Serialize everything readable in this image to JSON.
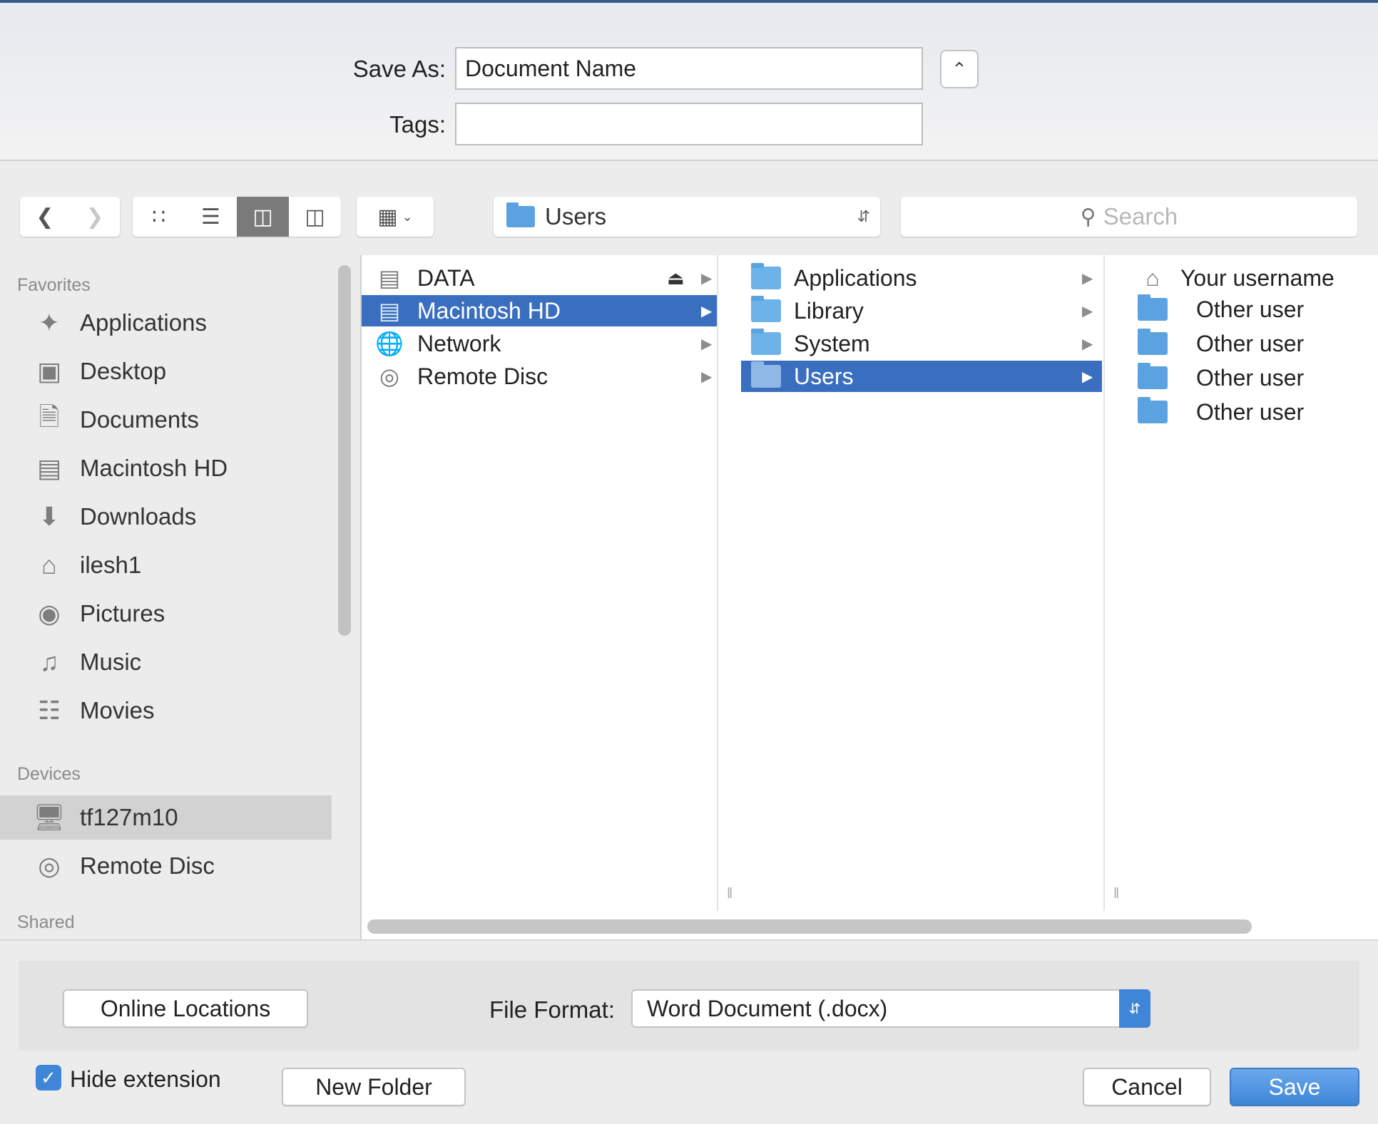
{
  "save_panel": {
    "save_as_label": "Save As:",
    "filename": "Document Name",
    "tags_label": "Tags:",
    "tags_value": ""
  },
  "toolbar": {
    "back_icon": "chevron-left-icon",
    "forward_icon": "chevron-right-icon",
    "view_icons": [
      "icon-view-icon",
      "list-view-icon",
      "column-view-icon",
      "cover-flow-icon"
    ],
    "active_view": "column",
    "path_popup": "Users",
    "search_placeholder": "Search"
  },
  "sidebar": {
    "favorites_header": "Favorites",
    "favorites": [
      {
        "label": "Applications",
        "icon": "applications-icon"
      },
      {
        "label": "Desktop",
        "icon": "desktop-icon"
      },
      {
        "label": "Documents",
        "icon": "documents-icon"
      },
      {
        "label": "Macintosh HD",
        "icon": "hard-drive-icon"
      },
      {
        "label": "Downloads",
        "icon": "downloads-icon"
      },
      {
        "label": "ilesh1",
        "icon": "home-icon"
      },
      {
        "label": "Pictures",
        "icon": "camera-icon"
      },
      {
        "label": "Music",
        "icon": "music-note-icon"
      },
      {
        "label": "Movies",
        "icon": "film-icon"
      }
    ],
    "devices_header": "Devices",
    "devices": [
      {
        "label": "tf127m10",
        "icon": "monitor-icon",
        "selected": true
      },
      {
        "label": "Remote Disc",
        "icon": "disc-icon"
      }
    ],
    "shared_header": "Shared"
  },
  "browser": {
    "col1": [
      {
        "label": "DATA",
        "icon": "external-drive-icon",
        "eject": true
      },
      {
        "label": "Macintosh HD",
        "icon": "hard-drive-icon",
        "selected": true
      },
      {
        "label": "Network",
        "icon": "globe-icon"
      },
      {
        "label": "Remote Disc",
        "icon": "disc-icon"
      }
    ],
    "col2": [
      {
        "label": "Applications",
        "icon": "applications-folder-icon"
      },
      {
        "label": "Library",
        "icon": "library-folder-icon"
      },
      {
        "label": "System",
        "icon": "system-folder-icon"
      },
      {
        "label": "Users",
        "icon": "users-folder-icon",
        "selected": true
      }
    ],
    "col3": [
      {
        "label": "Your username",
        "icon": "home-icon"
      },
      {
        "label": "Other user",
        "icon": "folder-icon"
      },
      {
        "label": "Other user",
        "icon": "folder-icon"
      },
      {
        "label": "Other user",
        "icon": "folder-icon"
      },
      {
        "label": "Other user",
        "icon": "folder-icon"
      }
    ]
  },
  "footer": {
    "online_locations": "Online Locations",
    "file_format_label": "File Format:",
    "file_format_value": "Word Document (.docx)",
    "hide_extension_label": "Hide extension",
    "hide_extension_checked": true,
    "new_folder": "New Folder",
    "cancel": "Cancel",
    "save": "Save"
  },
  "colors": {
    "selection": "#3a6fbf",
    "accent": "#3f86d8",
    "folder": "#5ba3e0"
  }
}
